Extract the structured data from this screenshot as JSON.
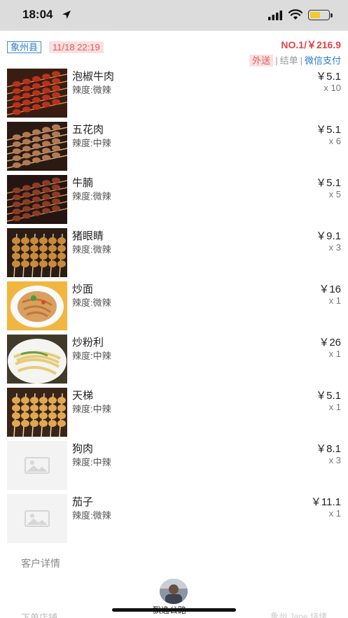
{
  "status_bar": {
    "time": "18:04",
    "battery_level": 0.6,
    "battery_color": "#f2c92e"
  },
  "order": {
    "county": "象州县",
    "time": "11/18 22:19",
    "number_total": "NO.1/￥216.9",
    "delivery": "外送",
    "bill": "结单",
    "payment": "微信支付",
    "separator": "|"
  },
  "items": [
    {
      "name": "泡椒牛肉",
      "spice": "辣度:微辣",
      "price": "￥5.1",
      "qty": "x 10",
      "photo": "skewers-red"
    },
    {
      "name": "五花肉",
      "spice": "辣度:中辣",
      "price": "￥5.1",
      "qty": "x 6",
      "photo": "skewers-pork"
    },
    {
      "name": "牛腩",
      "spice": "辣度:微辣",
      "price": "￥5.1",
      "qty": "x 5",
      "photo": "skewers-dark"
    },
    {
      "name": "猪眼睛",
      "spice": "辣度:微辣",
      "price": "￥9.1",
      "qty": "x 3",
      "photo": "skewers-upright"
    },
    {
      "name": "炒面",
      "spice": "辣度:微辣",
      "price": "￥16",
      "qty": "x 1",
      "photo": "fried-noodles"
    },
    {
      "name": "炒粉利",
      "spice": "辣度:中辣",
      "price": "￥26",
      "qty": "x 1",
      "photo": "fried-rice-cake"
    },
    {
      "name": "天梯",
      "spice": "辣度:中辣",
      "price": "￥5.1",
      "qty": "x 1",
      "photo": "skewers-golden"
    },
    {
      "name": "狗肉",
      "spice": "辣度:中辣",
      "price": "￥8.1",
      "qty": "x 3",
      "photo": "placeholder-image-icon"
    },
    {
      "name": "茄子",
      "spice": "辣度:微辣",
      "price": "￥11.1",
      "qty": "x 1",
      "photo": "placeholder-image-icon"
    }
  ],
  "customer": {
    "section_label": "客户详情"
  },
  "courier": {
    "name": "飘逸公路"
  },
  "footer": {
    "left_label": "下单店铺",
    "right_label": "象州 Jane 烧烤"
  },
  "colors": {
    "accent_red": "#e04444",
    "accent_blue": "#2a7bc8",
    "tag_pink_bg": "#fbe0e0"
  }
}
